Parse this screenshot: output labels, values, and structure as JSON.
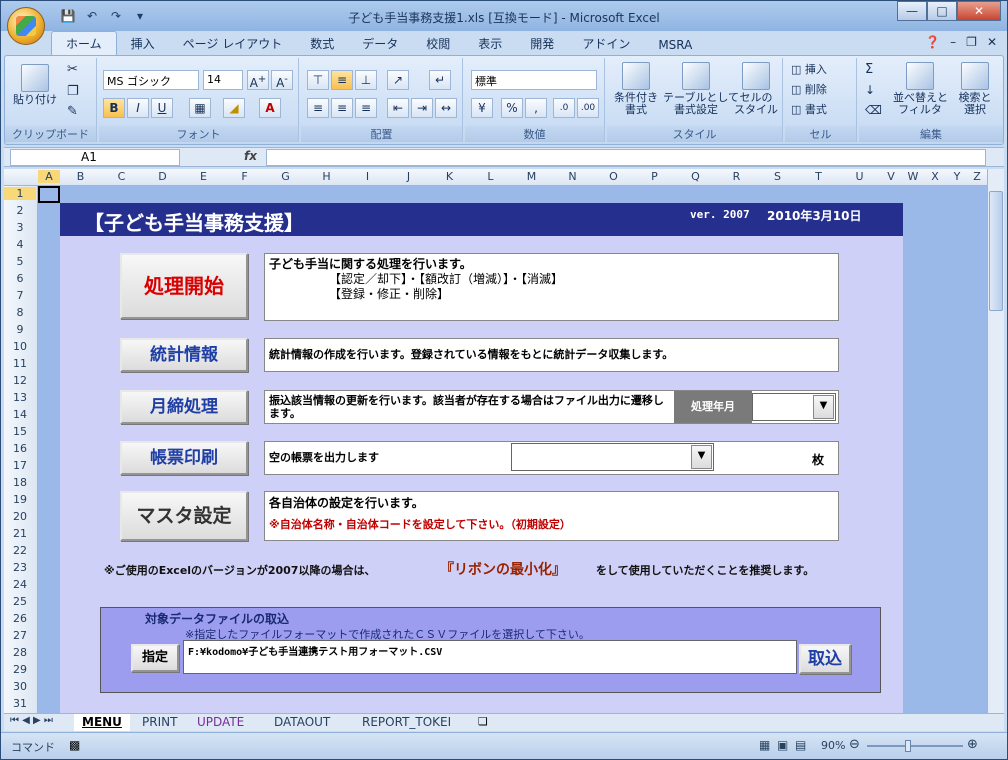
{
  "app": {
    "window_title": "子ども手当事務支援1.xls  [互換モード] - Microsoft Excel",
    "window_controls": [
      "—",
      "□",
      "✕"
    ]
  },
  "ribbon": {
    "tabs": [
      "ホーム",
      "挿入",
      "ページ レイアウト",
      "数式",
      "データ",
      "校閲",
      "表示",
      "開発",
      "アドイン",
      "MSRA"
    ],
    "clipboard": {
      "paste": "貼り付け",
      "label": "クリップボード"
    },
    "font": {
      "name": "MS ゴシック",
      "size": "14",
      "label": "フォント",
      "bold": "B",
      "italic": "I",
      "underline": "U"
    },
    "alignment": {
      "label": "配置"
    },
    "number": {
      "format": "標準",
      "label": "数値"
    },
    "styles": {
      "conditional": "条件付き\n書式",
      "table": "テーブルとして\n書式設定",
      "cell": "セルの\nスタイル",
      "label": "スタイル"
    },
    "cells": {
      "insert": "挿入",
      "delete": "削除",
      "format": "書式",
      "label": "セル"
    },
    "editing": {
      "sort": "並べ替えと\nフィルタ",
      "find": "検索と\n選択",
      "label": "編集"
    }
  },
  "formula_bar": {
    "name_box": "A1",
    "fx": "fx",
    "value": ""
  },
  "columns": [
    "A",
    "B",
    "C",
    "D",
    "E",
    "F",
    "G",
    "H",
    "I",
    "J",
    "K",
    "L",
    "M",
    "N",
    "O",
    "P",
    "Q",
    "R",
    "S",
    "T",
    "U",
    "V",
    "W",
    "X",
    "Y",
    "Z"
  ],
  "rows": [
    "1",
    "2",
    "3",
    "4",
    "5",
    "6",
    "7",
    "8",
    "9",
    "10",
    "11",
    "12",
    "13",
    "14",
    "15",
    "16",
    "17",
    "18",
    "19",
    "20",
    "21",
    "22",
    "23",
    "24",
    "25",
    "26",
    "27",
    "28",
    "29",
    "30",
    "31"
  ],
  "sheet": {
    "header_title": "【子ども手当事務支援】",
    "version": "ver. 2007",
    "date": "2010年3月10日",
    "start_button": "処理開始",
    "start_desc_line1": "子ども手当に関する処理を行います。",
    "start_desc_line2": "【認定／却下】・【額改訂（増減）】・【消滅】",
    "start_desc_line3": "【登録・修正・削除】",
    "stats_button": "統計情報",
    "stats_desc": "統計情報の作成を行います。登録されている情報をもとに統計データ収集します。",
    "monthly_button": "月締処理",
    "monthly_desc": "振込該当情報の更新を行います。該当者が存在する場合はファイル出力に遷移します。",
    "monthly_label": "処理年月",
    "monthly_value": "",
    "print_button": "帳票印刷",
    "print_desc": "空の帳票を出力します",
    "print_select_value": "",
    "print_unit": "枚",
    "master_button": "マスタ設定",
    "master_desc": "各自治体の設定を行います。",
    "master_note": "※自治体名称・自治体コードを設定して下さい。（初期設定）",
    "notice_prefix": "※ご使用のExcelのバージョンが2007以降の場合は、",
    "notice_highlight": "『リボンの最小化』",
    "notice_suffix": "をして使用していただくことを推奨します。",
    "import_title": "対象データファイルの取込",
    "import_hint": "※指定したファイルフォーマットで作成されたＣＳＶファイルを選択して下さい。",
    "specify_button": "指定",
    "file_path": "F:¥kodomo¥子ども手当連携テスト用フォーマット.CSV",
    "import_button": "取込"
  },
  "sheet_tabs": [
    "MENU",
    "PRINT",
    "UPDATE",
    "DATAOUT",
    "REPORT_TOKEI"
  ],
  "status": {
    "mode": "コマンド",
    "zoom": "90%"
  }
}
